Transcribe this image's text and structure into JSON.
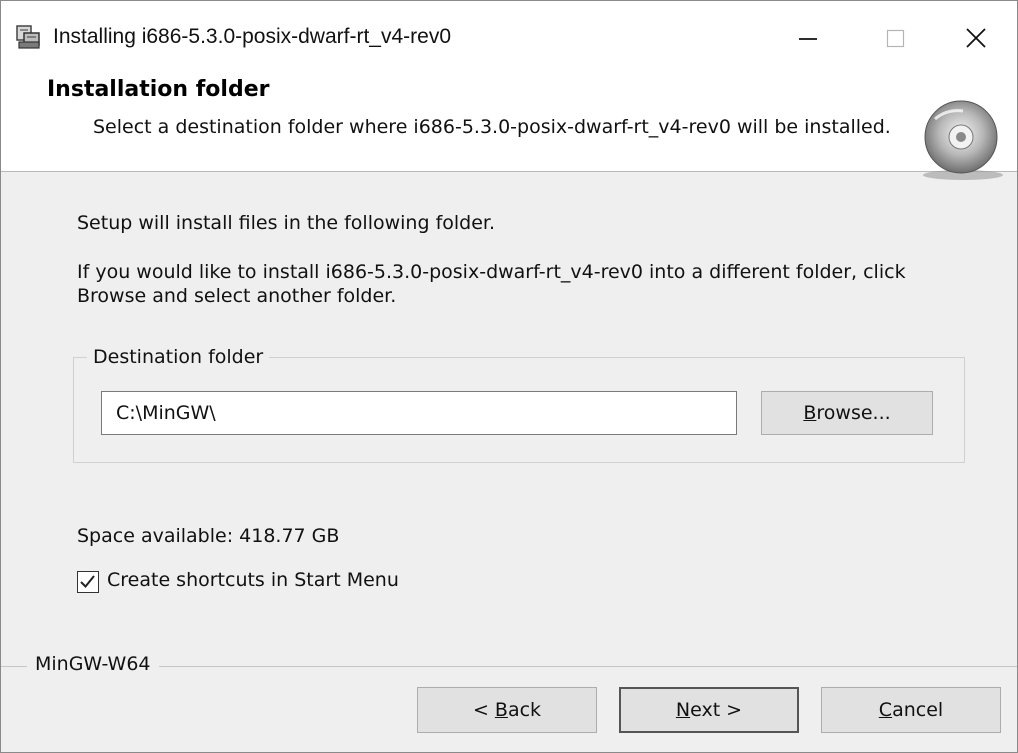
{
  "window": {
    "title": "Installing i686-5.3.0-posix-dwarf-rt_v4-rev0",
    "icons": {
      "app": "setup-icon",
      "minimize": "minimize-icon",
      "maximize": "maximize-icon",
      "close": "close-icon"
    }
  },
  "header": {
    "title": "Installation folder",
    "description": "Select a destination folder where i686-5.3.0-posix-dwarf-rt_v4-rev0 will be installed.",
    "icon": "disc-icon"
  },
  "content": {
    "intro": "Setup will install files in the following folder.",
    "instructions": "If you would like to install i686-5.3.0-posix-dwarf-rt_v4-rev0 into a different folder, click Browse and select another folder.",
    "destination": {
      "legend": "Destination folder",
      "path": "C:\\MinGW\\",
      "browse_underlined": "B",
      "browse_rest": "rowse..."
    },
    "space_available": "Space available: 418.77 GB",
    "shortcuts": {
      "label": "Create shortcuts in Start Menu",
      "checked": true
    }
  },
  "footer": {
    "brand": "MinGW-W64",
    "back": {
      "prefix": "< ",
      "underlined": "B",
      "rest": "ack"
    },
    "next": {
      "underlined": "N",
      "rest": "ext >"
    },
    "cancel": {
      "underlined": "C",
      "rest": "ancel"
    }
  },
  "colors": {
    "background": "#efefef",
    "button": "#e1e1e1",
    "header": "#ffffff"
  }
}
